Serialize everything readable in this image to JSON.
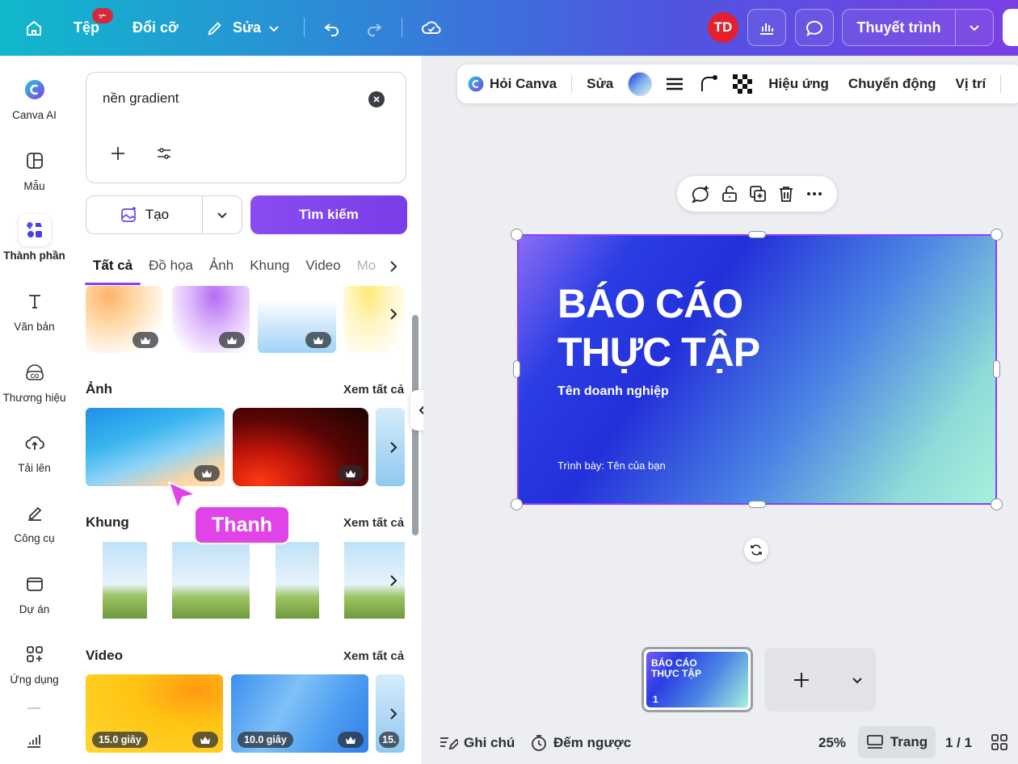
{
  "topbar": {
    "file_label": "Tệp",
    "file_badge": "✃",
    "resize_label": "Đổi cỡ",
    "edit_label": "Sửa",
    "avatar_initials": "TD",
    "present_label": "Thuyết trình",
    "icons": [
      "home-icon",
      "pencil-icon",
      "undo-icon",
      "redo-icon",
      "cloud-check-icon",
      "chart-icon",
      "comment-icon",
      "chevron-down-icon"
    ]
  },
  "rail": {
    "items": [
      {
        "label": "Canva AI",
        "icon": "canva-ai-icon"
      },
      {
        "label": "Mẫu",
        "icon": "template-icon"
      },
      {
        "label": "Thành phần",
        "icon": "elements-icon"
      },
      {
        "label": "Văn bản",
        "icon": "text-icon"
      },
      {
        "label": "Thương hiệu",
        "icon": "brand-icon"
      },
      {
        "label": "Tải lên",
        "icon": "upload-icon"
      },
      {
        "label": "Công cụ",
        "icon": "draw-icon"
      },
      {
        "label": "Dự án",
        "icon": "folder-icon"
      },
      {
        "label": "Ứng dụng",
        "icon": "apps-icon"
      }
    ],
    "active": "Thành phần"
  },
  "panel": {
    "search_value": "nền gradient",
    "create_label": "Tạo",
    "search_button": "Tìm kiếm",
    "tabs": [
      "Tất cả",
      "Đồ họa",
      "Ảnh",
      "Khung",
      "Video",
      "Mo"
    ],
    "active_tab": "Tất cả",
    "sections": {
      "photos": {
        "title": "Ảnh",
        "see_all": "Xem tất cả"
      },
      "frames": {
        "title": "Khung",
        "see_all": "Xem tất cả"
      },
      "videos": {
        "title": "Video",
        "see_all": "Xem tất cả",
        "durations": [
          "15.0 giây",
          "10.0 giây",
          "15."
        ]
      }
    }
  },
  "cursor_label": "Thanh",
  "context_toolbar": {
    "ask_canva": "Hỏi Canva",
    "edit": "Sửa",
    "effects": "Hiệu ứng",
    "animate": "Chuyển động",
    "position": "Vị trí"
  },
  "slide": {
    "title_line1": "BÁO CÁO",
    "title_line2": "THỰC TẬP",
    "subtitle": "Tên doanh nghiệp",
    "presenter": "Trình bày: Tên của bạn"
  },
  "page_thumb": {
    "title_line1": "BÁO CÁO",
    "title_line2": "THỰC TẬP",
    "number": "1"
  },
  "bottom": {
    "notes": "Ghi chú",
    "timer": "Đếm ngược",
    "zoom": "25%",
    "pages": "Trang",
    "page_count": "1 / 1"
  },
  "colors": {
    "accent": "#8b3dff",
    "avatar": "#e2202e",
    "cursor_tag": "#e044e8"
  }
}
